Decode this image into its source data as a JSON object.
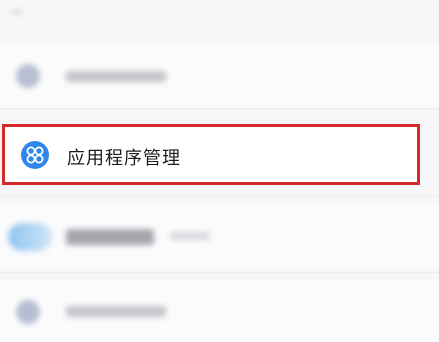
{
  "settings_list": {
    "highlighted_item": {
      "label": "应用程序管理",
      "icon": "app-management-icon",
      "icon_color": "#2f86ef"
    },
    "highlight_color": "#d42a2a"
  }
}
